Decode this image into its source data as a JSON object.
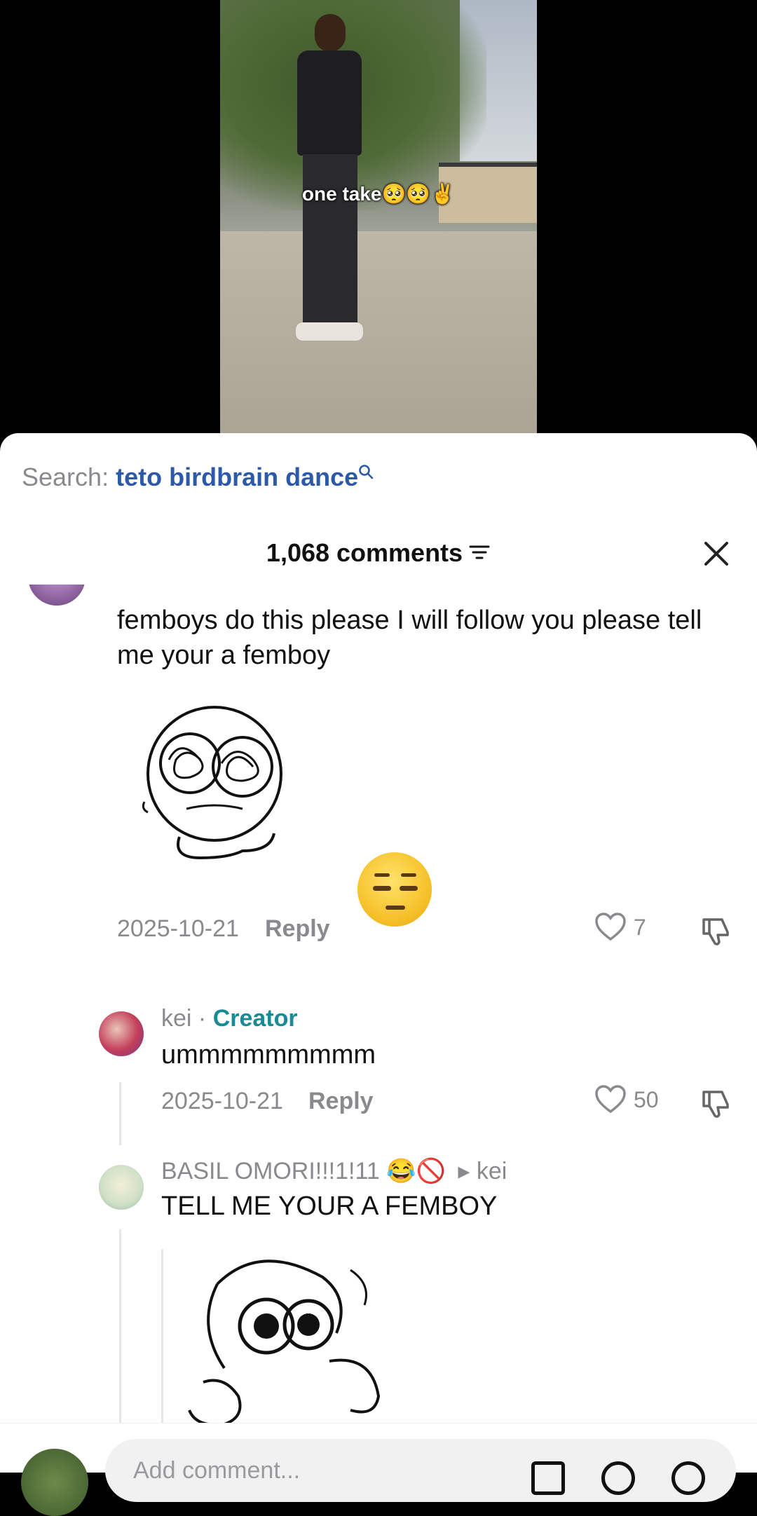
{
  "video": {
    "caption": "one take🥺🥺✌️"
  },
  "search": {
    "label": "Search:",
    "term": "teto birdbrain dance"
  },
  "comments_header": {
    "count": "1,068 comments"
  },
  "comments": [
    {
      "text": "femboys do this please I will follow you please tell me your a femboy",
      "date": "2025-10-21",
      "reply": "Reply",
      "likes": "7"
    },
    {
      "author": "kei",
      "separator": "·",
      "badge": "Creator",
      "text": "ummmmmmmmm",
      "date": "2025-10-21",
      "reply": "Reply",
      "likes": "50"
    },
    {
      "author": "BASIL OMORI!!!1!11 😂🚫",
      "reply_to_arrow": "▸",
      "reply_to": "kei",
      "text": "TELL ME YOUR A FEMBOY"
    }
  ],
  "composer": {
    "placeholder": "Add comment..."
  },
  "icons": [
    "search-icon",
    "filter-icon",
    "close-icon",
    "heart-icon",
    "dislike-icon",
    "image-icon",
    "emoji-icon",
    "mention-icon"
  ],
  "colors": {
    "search_term": "#2c5aa8",
    "creator_badge": "#198a96",
    "muted": "#8a8a8e"
  }
}
